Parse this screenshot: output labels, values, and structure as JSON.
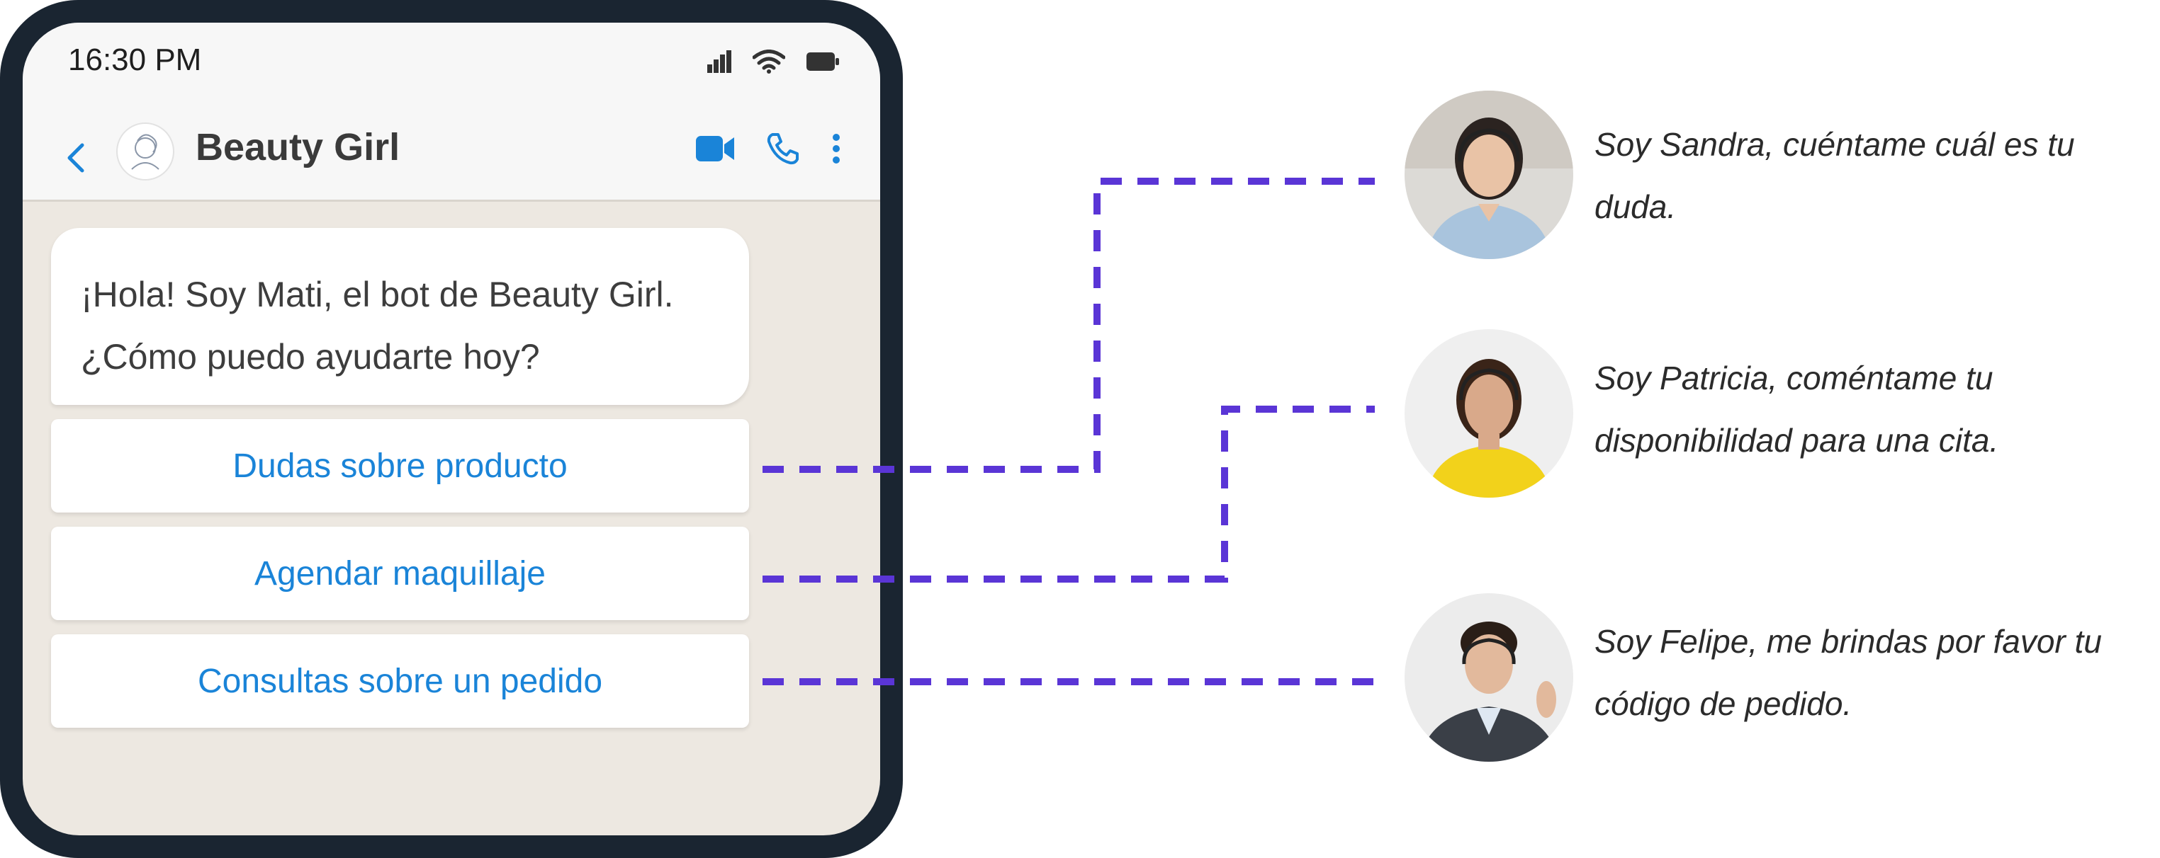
{
  "status_bar": {
    "time": "16:30 PM"
  },
  "chat_header": {
    "title": "Beauty Girl"
  },
  "bot_message": "¡Hola! Soy Mati, el bot de Beauty Girl. ¿Cómo puedo ayudarte hoy?",
  "quick_replies": [
    {
      "label": "Dudas sobre producto"
    },
    {
      "label": "Agendar maquillaje"
    },
    {
      "label": "Consultas sobre un pedido"
    }
  ],
  "agents": [
    {
      "message": "Soy Sandra, cuéntame cuál es tu duda."
    },
    {
      "message": "Soy Patricia, coméntame tu disponibilidad para una cita."
    },
    {
      "message": "Soy Felipe, me brindas por favor tu código de pedido."
    }
  ],
  "colors": {
    "phone_frame": "#1a2531",
    "chat_background": "#ede8e1",
    "accent_blue": "#1a84d8",
    "connector_purple": "#5a35d6"
  },
  "icons": [
    "signal-icon",
    "wifi-icon",
    "battery-icon",
    "back-arrow-icon",
    "video-call-icon",
    "phone-call-icon",
    "more-options-icon"
  ]
}
